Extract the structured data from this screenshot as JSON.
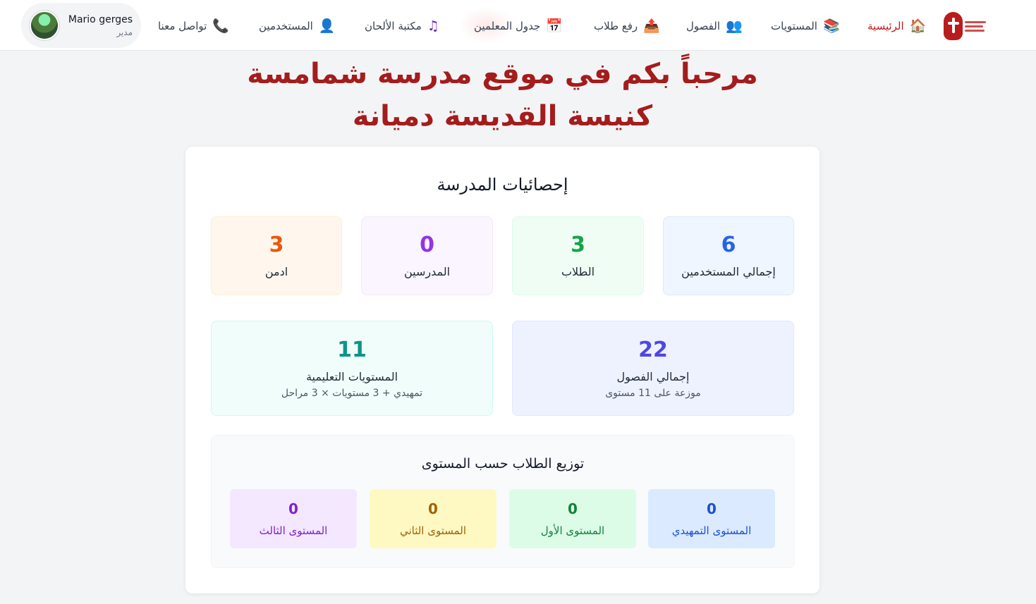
{
  "nav": {
    "items": [
      {
        "label": "الرئيسية",
        "icon": "home-icon",
        "active": true
      },
      {
        "label": "المستويات",
        "icon": "books-icon"
      },
      {
        "label": "الفصول",
        "icon": "users-group-icon"
      },
      {
        "label": "رفع طلاب",
        "icon": "upload-tray-icon"
      },
      {
        "label": "جدول المعلمين",
        "icon": "calendar-icon"
      },
      {
        "label": "مكتبة الألحان",
        "icon": "music-note-icon"
      },
      {
        "label": "المستخدمين",
        "icon": "user-icon"
      },
      {
        "label": "تواصل معنا",
        "icon": "phone-icon"
      }
    ],
    "user": {
      "name": "Mario gerges",
      "role": "مدير"
    }
  },
  "hero": {
    "line1": "مرحباً بكم في موقع مدرسة شمامسة",
    "line2": "كنيسة القديسة دميانة"
  },
  "stats": {
    "title": "إحصائيات المدرسة",
    "total_users": {
      "value": "6",
      "label": "إجمالي المستخدمين"
    },
    "students": {
      "value": "3",
      "label": "الطلاب"
    },
    "teachers": {
      "value": "0",
      "label": "المدرسين"
    },
    "admins": {
      "value": "3",
      "label": "ادمن"
    },
    "total_classes": {
      "value": "22",
      "label": "إجمالي الفصول",
      "sub": "موزعة على 11 مستوى"
    },
    "levels": {
      "value": "11",
      "label": "المستويات التعليمية",
      "sub": "تمهيدي + 3 مستويات × 3 مراحل"
    }
  },
  "distribution": {
    "title": "توزيع الطلاب حسب المستوى",
    "levels": [
      {
        "value": "0",
        "label": "المستوى التمهيدي"
      },
      {
        "value": "0",
        "label": "المستوى الأول"
      },
      {
        "value": "0",
        "label": "المستوى الثاني"
      },
      {
        "value": "0",
        "label": "المستوى الثالث"
      }
    ]
  },
  "colors": {
    "brand": "#a41c1c",
    "blue": "#2563eb",
    "green": "#16a34a",
    "purple": "#9333ea",
    "orange": "#ea580c",
    "indigo": "#4f46e5",
    "teal": "#0d9488"
  }
}
